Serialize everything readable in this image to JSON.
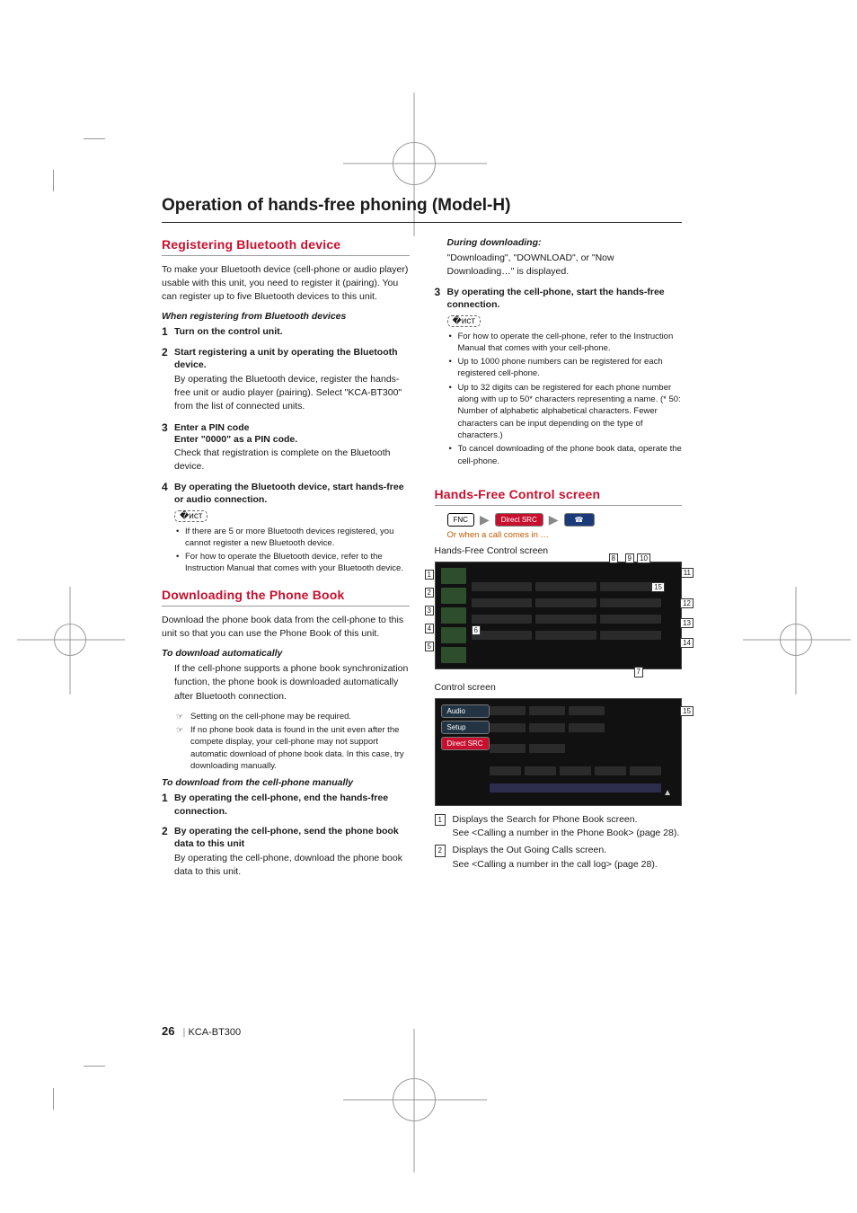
{
  "title": "Operation of hands-free phoning (Model-H)",
  "page_number": "26",
  "product_model": "KCA-BT300",
  "left": {
    "h_register": "Registering Bluetooth device",
    "register_intro": "To make your Bluetooth device (cell-phone or audio player) usable with this unit, you need to register it (pairing). You can register up to five Bluetooth devices to this unit.",
    "register_sub": "When registering from Bluetooth devices",
    "steps_register": [
      {
        "n": "1",
        "head": "Turn on the control unit."
      },
      {
        "n": "2",
        "head": "Start registering a unit by operating the Bluetooth device.",
        "body": "By operating the Bluetooth device, register the hands-free unit or audio player (pairing). Select \"KCA-BT300\" from the list of connected units."
      },
      {
        "n": "3",
        "head": "Enter a PIN code",
        "sub": "Enter \"0000\" as a PIN code.",
        "body": "Check that registration is complete on the Bluetooth device."
      },
      {
        "n": "4",
        "head": "By operating the Bluetooth device, start hands-free or audio connection."
      }
    ],
    "notes_register": [
      "If there are 5 or more Bluetooth devices registered, you cannot register a new Bluetooth device.",
      "For how to operate the Bluetooth device, refer to the Instruction Manual that comes with your Bluetooth device."
    ],
    "h_download": "Downloading the Phone Book",
    "download_intro": "Download the phone book data from the cell-phone to this unit so that you can use the Phone Book of this unit.",
    "download_sub_auto": "To download automatically",
    "download_auto_body": "If the cell-phone supports a phone book synchronization function, the phone book is downloaded automatically after Bluetooth connection.",
    "download_auto_notes": [
      "Setting on the cell-phone may be required.",
      "If no phone book data is found in the unit even after the compete display, your cell-phone may not support automatic download of phone book data. In this case, try downloading manually."
    ],
    "download_sub_manual": "To download from the cell-phone manually",
    "steps_manual": [
      {
        "n": "1",
        "head": "By operating the cell-phone, end the hands-free connection."
      },
      {
        "n": "2",
        "head": "By operating the cell-phone, send the phone book data to this unit",
        "body": "By operating the cell-phone, download the phone book data to this unit."
      }
    ]
  },
  "right": {
    "during_sub": "During downloading:",
    "during_body": "\"Downloading\", \"DOWNLOAD\", or \"Now Downloading…\" is displayed.",
    "step3": {
      "n": "3",
      "head": "By operating the cell-phone, start the hands-free connection."
    },
    "notes_right": [
      "For how to operate the cell-phone, refer to the Instruction Manual that comes with your cell-phone.",
      "Up to 1000 phone numbers can be registered for each registered cell-phone.",
      "Up to 32 digits can be registered for each phone number along with up to 50* characters representing a name. (* 50: Number of alphabetic alphabetical characters. Fewer characters can be input depending on the type of characters.)",
      "To cancel downloading of the phone book data, operate the cell-phone."
    ],
    "h_control": "Hands-Free Control screen",
    "fnc_label": "FNC",
    "direct_src_label": "Direct SRC",
    "incoming_caption": "Or when a call comes in …",
    "caption_hf": "Hands-Free Control screen",
    "caption_ctrl": "Control screen",
    "ctrl_buttons": [
      "Audio",
      "Setup",
      "Direct SRC"
    ],
    "callouts_top": [
      "8",
      "9",
      "10",
      "11",
      "12",
      "13",
      "14",
      "15"
    ],
    "callouts_left": [
      "1",
      "2",
      "3",
      "4",
      "5",
      "6",
      "7"
    ],
    "ctrl_callout": "15",
    "legend": [
      {
        "n": "1",
        "t": "Displays the Search for Phone Book screen.",
        "t2": "See <Calling a number in the Phone Book> (page 28)."
      },
      {
        "n": "2",
        "t": "Displays the Out Going Calls screen.",
        "t2": "See <Calling a number in the call log> (page 28)."
      }
    ]
  }
}
